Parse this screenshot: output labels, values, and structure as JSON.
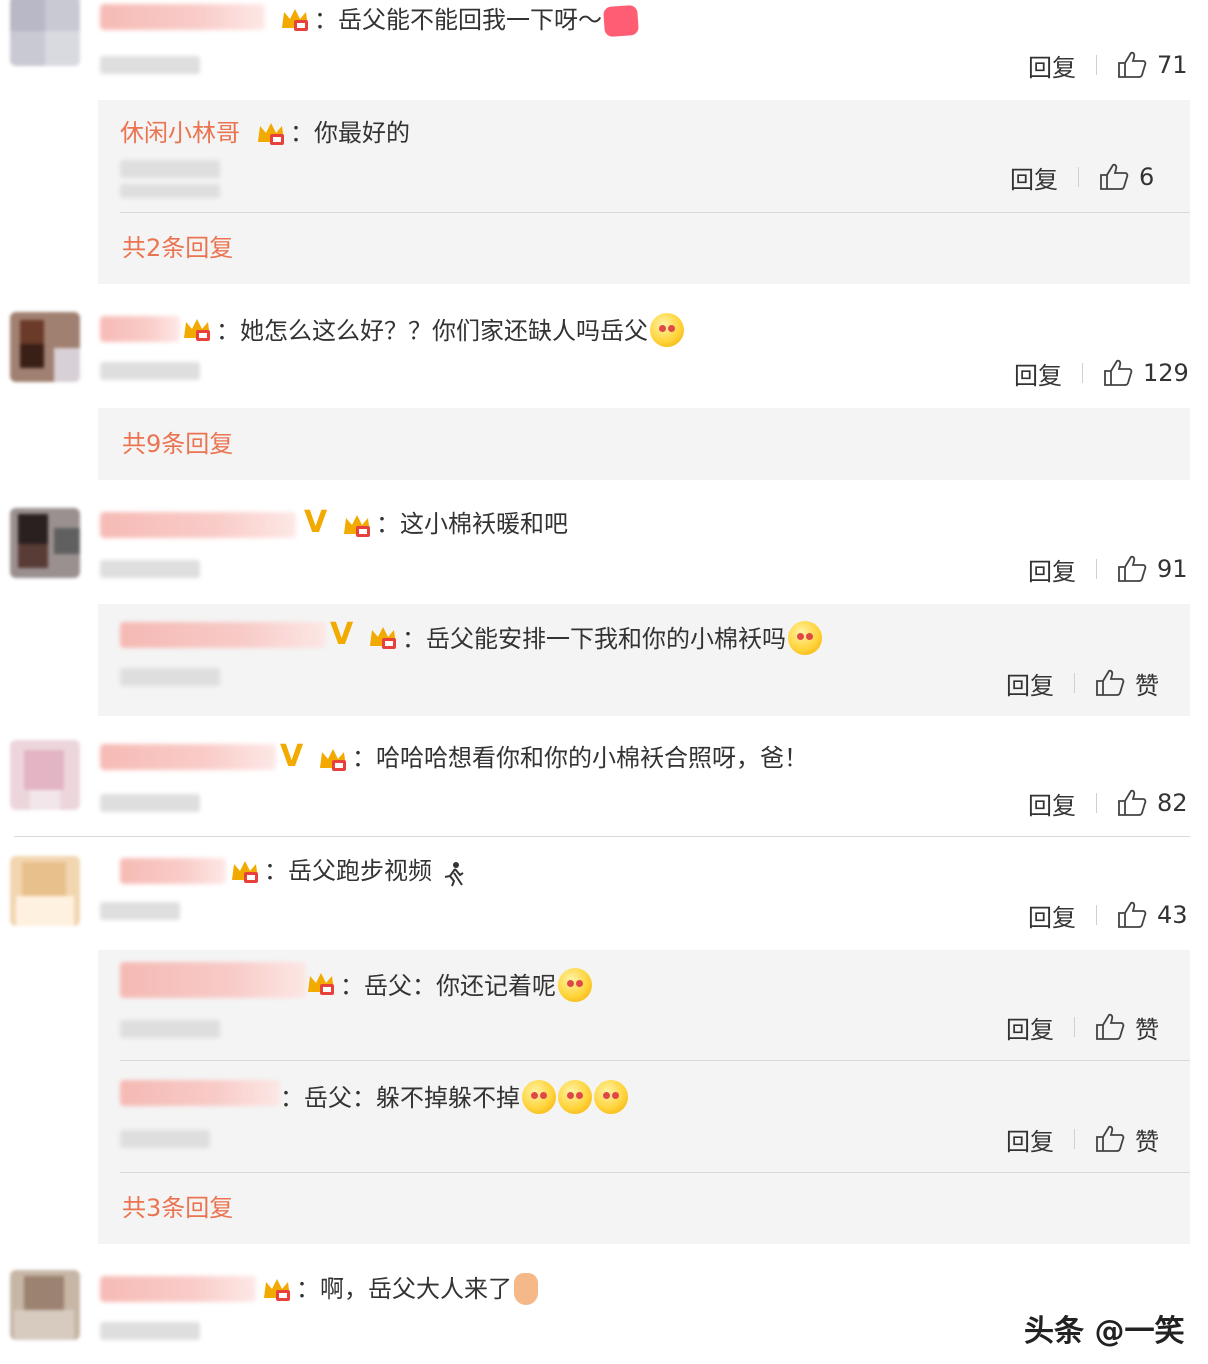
{
  "comments": [
    {
      "text": "：岳父能不能回我一下呀～",
      "reply_label": "回复",
      "likes": "71",
      "subreplies": [
        {
          "name": "休闲小林哥",
          "text": "：你最好的",
          "reply_label": "回复",
          "likes": "6"
        }
      ],
      "more_label": "共2条回复"
    },
    {
      "text": "：她怎么这么好？？你们家还缺人吗岳父",
      "reply_label": "回复",
      "likes": "129",
      "more_label": "共9条回复"
    },
    {
      "text": "：这小棉袄暖和吧",
      "reply_label": "回复",
      "likes": "91",
      "subreplies": [
        {
          "text": "：岳父能安排一下我和你的小棉袄吗",
          "reply_label": "回复",
          "likes": "赞"
        }
      ]
    },
    {
      "text": "：哈哈哈想看你和你的小棉袄合照呀，爸！",
      "reply_label": "回复",
      "likes": "82"
    },
    {
      "text": "：岳父跑步视频",
      "reply_label": "回复",
      "likes": "43",
      "subreplies": [
        {
          "text": "：岳父：你还记着呢",
          "reply_label": "回复",
          "likes": "赞"
        },
        {
          "text": "：岳父：躲不掉躲不掉",
          "reply_label": "回复",
          "likes": "赞"
        }
      ],
      "more_label": "共3条回复"
    },
    {
      "text": "：啊，岳父大人来了"
    }
  ],
  "watermark": "头条 @一笑",
  "icons": {
    "crown": "crown-icon",
    "vip": "v-badge-icon",
    "like": "thumbs-up-icon"
  },
  "colors": {
    "link": "#eb7350",
    "text": "#333333",
    "subbox": "#f4f4f4",
    "vip": "#f2a900"
  }
}
